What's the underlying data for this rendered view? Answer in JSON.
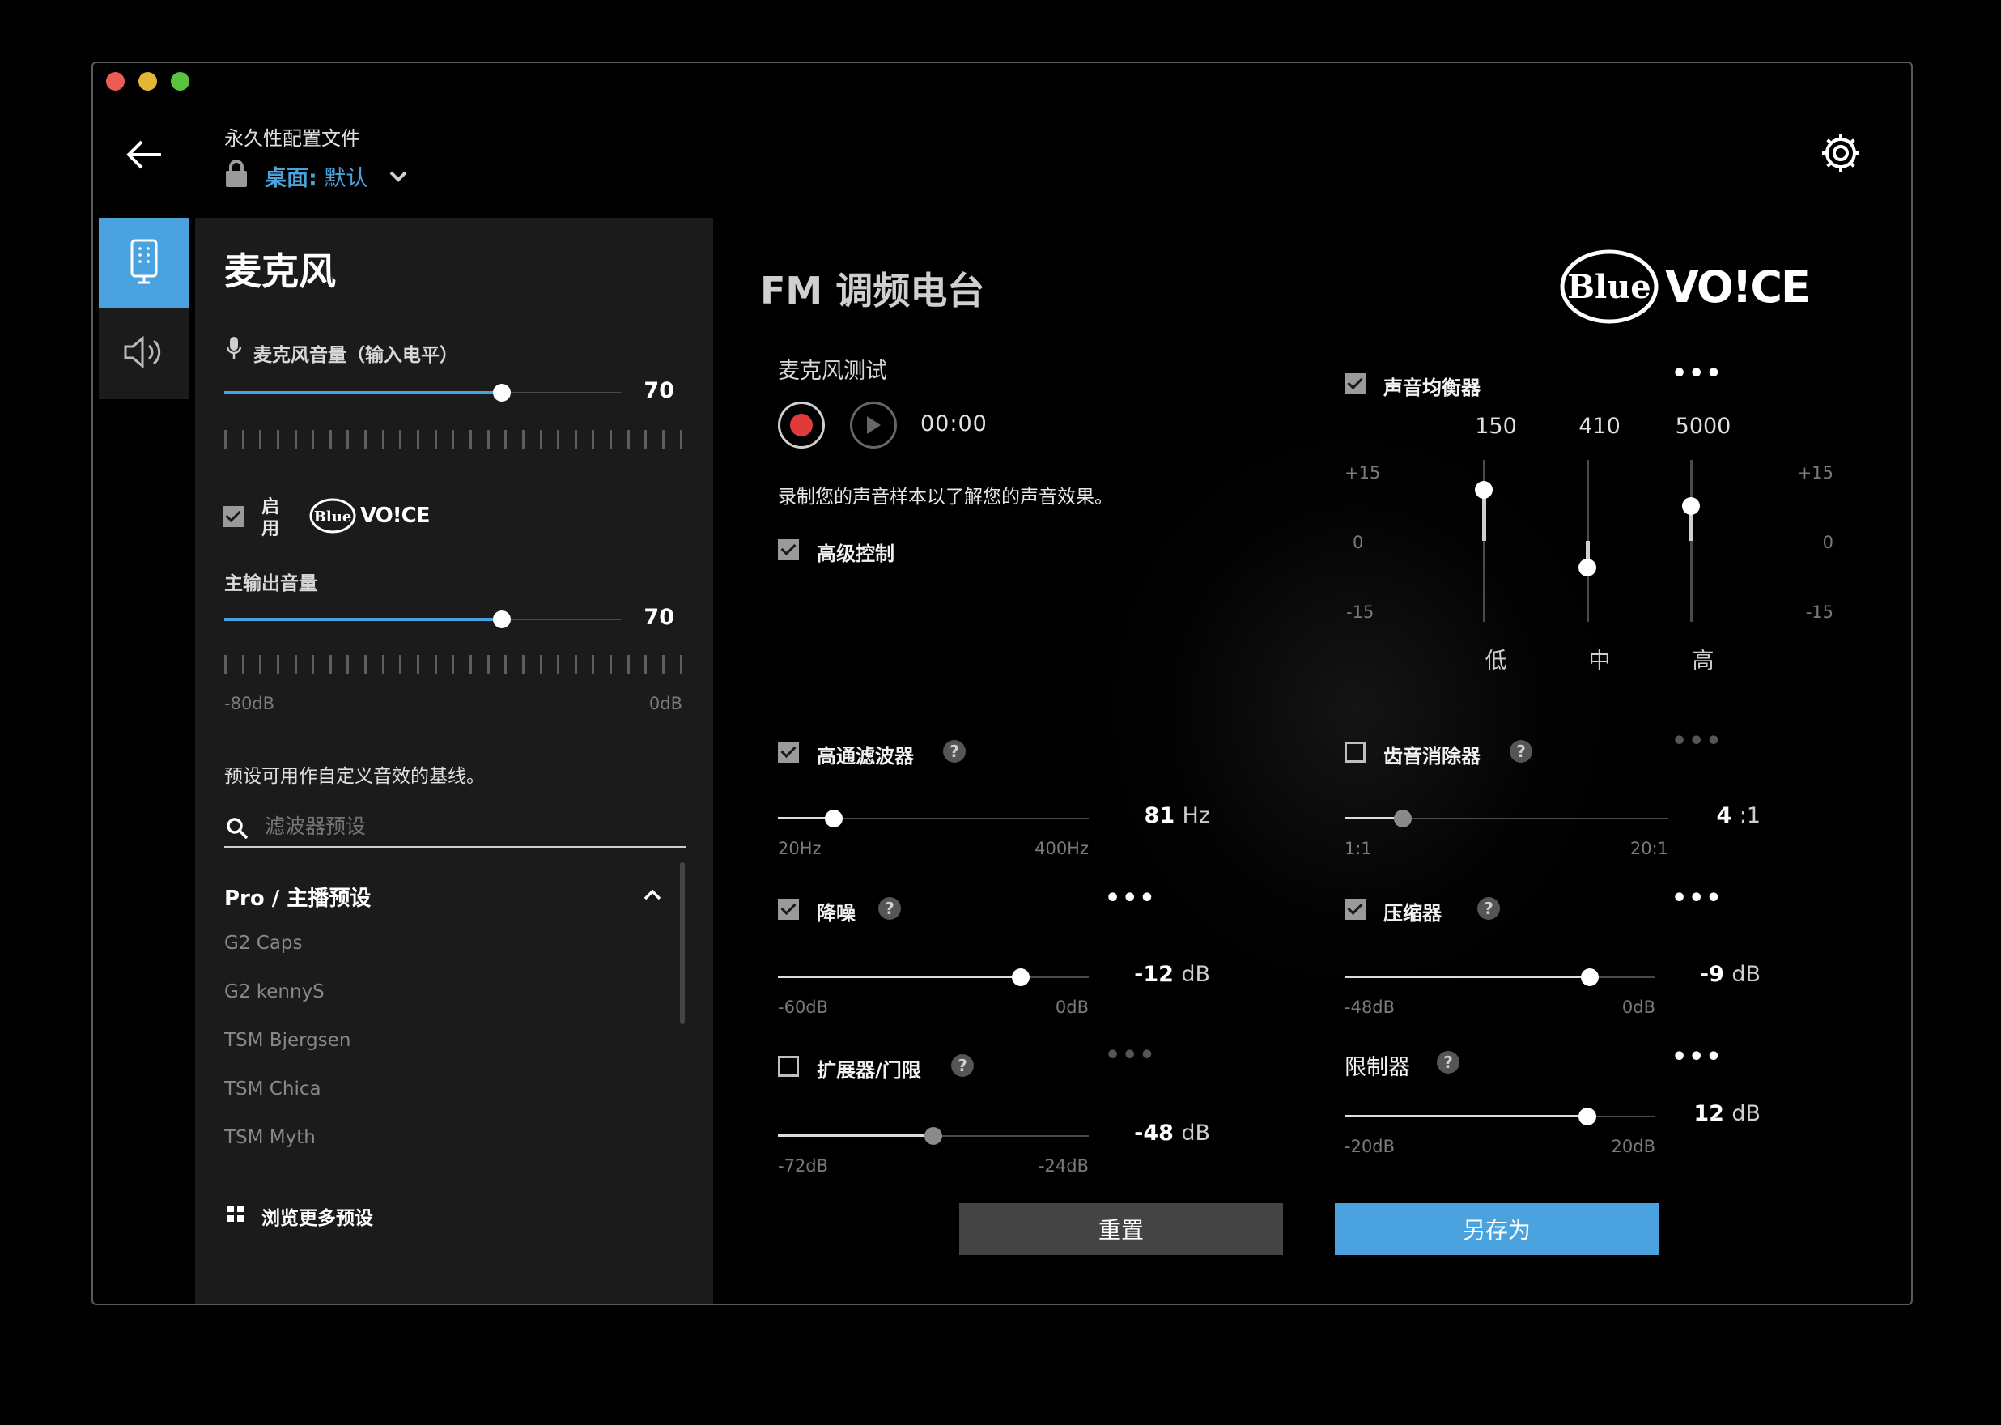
{
  "header": {
    "profile_caption": "永久性配置文件",
    "profile_name_prefix": "桌面:",
    "profile_name": "默认"
  },
  "sidebar": {
    "title": "麦克风",
    "mic_volume": {
      "label": "麦克风音量（输入电平）",
      "value": "70",
      "level": 0.7
    },
    "enable_label": "启用",
    "blue_voice_enabled": true,
    "output_volume": {
      "label": "主输出音量",
      "value": "70",
      "level": 0.7,
      "min_label": "-80dB",
      "max_label": "0dB"
    },
    "preset_hint": "预设可用作自定义音效的基线。",
    "search_placeholder": "滤波器预设",
    "preset_group": "Pro / 主播预设",
    "presets": [
      "G2 Caps",
      "G2 kennyS",
      "TSM Bjergsen",
      "TSM Chica",
      "TSM Myth"
    ],
    "browse_more": "浏览更多预设"
  },
  "main": {
    "title": "FM 调频电台",
    "brand_blue": "Blue",
    "brand_voice": "VO!CE",
    "mic_test": {
      "label": "麦克风测试",
      "time": "00:00",
      "description": "录制您的声音样本以了解您的声音效果。"
    },
    "advanced": {
      "label": "高级控制",
      "checked": true
    },
    "equalizer": {
      "label": "声音均衡器",
      "checked": true,
      "bands": [
        {
          "freq": "150",
          "name": "低",
          "gain_db": 10
        },
        {
          "freq": "410",
          "name": "中",
          "gain_db": -5
        },
        {
          "freq": "5000",
          "name": "高",
          "gain_db": 11
        }
      ],
      "scale": [
        "+15",
        "0",
        "-15"
      ]
    },
    "highpass": {
      "label": "高通滤波器",
      "checked": true,
      "value": "81",
      "unit": "Hz",
      "min": "20Hz",
      "max": "400Hz",
      "level": 0.18
    },
    "deesser": {
      "label": "齿音消除器",
      "checked": false,
      "value": "4",
      "unit": ":1",
      "min": "1:1",
      "max": "20:1",
      "level": 0.18
    },
    "noise": {
      "label": "降噪",
      "checked": true,
      "value": "-12",
      "unit": "dB",
      "min": "-60dB",
      "max": "0dB",
      "level": 0.78
    },
    "compressor": {
      "label": "压缩器",
      "checked": true,
      "value": "-9",
      "unit": "dB",
      "min": "-48dB",
      "max": "0dB",
      "level": 0.79
    },
    "expander": {
      "label": "扩展器/门限",
      "checked": false,
      "value": "-48",
      "unit": "dB",
      "min": "-72dB",
      "max": "-24dB",
      "level": 0.5
    },
    "limiter": {
      "label": "限制器",
      "value": "12",
      "unit": "dB",
      "min": "-20dB",
      "max": "20dB",
      "level": 0.78
    },
    "reset_button": "重置",
    "save_as_button": "另存为"
  },
  "colors": {
    "accent": "#4aa3df",
    "record": "#e03a3a"
  }
}
